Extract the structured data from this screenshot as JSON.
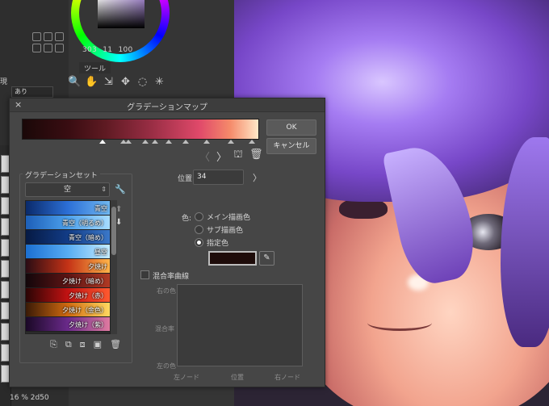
{
  "background": {
    "hsv_values": [
      "303",
      "11",
      "100"
    ],
    "tool_panel_title": "ツール",
    "side_label": "現",
    "side_dropdown_value": "あり",
    "status_text": "16 %  2d50"
  },
  "dialog": {
    "title": "グラデーションマップ",
    "close_icon": "×",
    "ok_label": "OK",
    "cancel_label": "キャンセル",
    "nav": {
      "prev": "〈",
      "next": "〉",
      "lock": "⛫",
      "trash": "🗑"
    },
    "gradient_set_label": "グラデーションセット",
    "set_select_value": "空",
    "presets": [
      {
        "label": "青空",
        "colors": [
          "#0a2a6a",
          "#2c6fd6",
          "#6fb7f0"
        ]
      },
      {
        "label": "青空（明るめ）",
        "colors": [
          "#1d5fb8",
          "#4ca0ec",
          "#a6dcff"
        ]
      },
      {
        "label": "青空（暗め）",
        "colors": [
          "#061a44",
          "#123c86",
          "#3b78c9"
        ]
      },
      {
        "label": "昼空",
        "colors": [
          "#1b6fd1",
          "#57acf2",
          "#c5ecff"
        ]
      },
      {
        "label": "夕焼け",
        "colors": [
          "#2a0c14",
          "#c43216",
          "#ffb449"
        ]
      },
      {
        "label": "夕焼け（暗め）",
        "colors": [
          "#12060a",
          "#5c1414",
          "#b03a24"
        ]
      },
      {
        "label": "夕焼け（赤）",
        "colors": [
          "#2a0404",
          "#c21212",
          "#ff5a30"
        ]
      },
      {
        "label": "夕焼け（金色）",
        "colors": [
          "#3a1a06",
          "#d06a10",
          "#ffd860"
        ]
      },
      {
        "label": "夕焼け（紫）",
        "colors": [
          "#1a0826",
          "#6a2a8a",
          "#e07aa0"
        ]
      }
    ],
    "list_tools": [
      "⎘",
      "⧉",
      "⧈",
      "▣",
      "🗑"
    ],
    "position_label": "位置:",
    "position_value": "34",
    "color_label": "色:",
    "color_options": [
      {
        "label": "メイン描画色",
        "selected": false
      },
      {
        "label": "サブ描画色",
        "selected": false
      },
      {
        "label": "指定色",
        "selected": true
      }
    ],
    "specified_color": "#1e0c0a",
    "blend_curve_label": "混合率曲線",
    "blend_curve_checked": false,
    "curve_axis": {
      "top_left": "右の色",
      "mid_left": "混合率",
      "bottom_left": "左の色",
      "bottom_x_left": "左ノード",
      "bottom_x_mid": "位置",
      "bottom_x_right": "右ノード"
    },
    "gradient_stops": [
      {
        "color": "#1a0808",
        "pos": 0
      },
      {
        "color": "#3a0d12",
        "pos": 20
      },
      {
        "color": "#5e1a22",
        "pos": 35
      },
      {
        "color": "#9a2e45",
        "pos": 55
      },
      {
        "color": "#e0496a",
        "pos": 75
      },
      {
        "color": "#f58a6a",
        "pos": 88
      },
      {
        "color": "#ffe8c8",
        "pos": 100
      }
    ],
    "nodes_percent": [
      34,
      43,
      45,
      52,
      56,
      62,
      69,
      78,
      88,
      97
    ]
  }
}
